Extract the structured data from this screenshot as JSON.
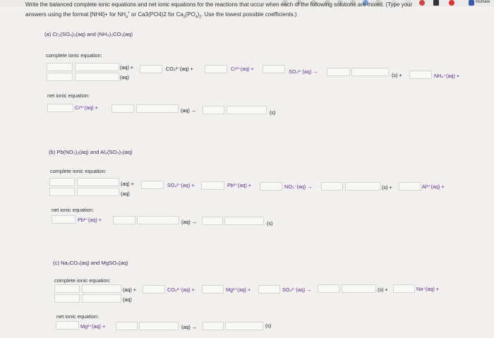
{
  "toolbar": {
    "homework_label": "Homew",
    "icons": [
      "circle-icon",
      "circle-icon",
      "circle-icon",
      "circle-icon",
      "check-icon",
      "puzzle-icon",
      "cloud-icon",
      "g-icon",
      "grid-icon",
      "n-icon",
      "p-icon",
      "record-icon",
      "w-icon"
    ]
  },
  "instructions": {
    "line1": "Write the balanced complete ionic equations and net ionic equations for the reactions that occur when each of the following solutions are mixed. (Type your",
    "line2_a": "answers using the format [NH4]+ for NH",
    "line2_b": "4",
    "line2_c": "+",
    "line2_d": " or Ca3(PO4)2 for Ca",
    "line2_e": "3",
    "line2_f": "(PO",
    "line2_g": "4",
    "line2_h": ")",
    "line2_i": "2",
    "line2_j": ". Use the lowest possible coefficients.)"
  },
  "part_a": {
    "title": "(a) Cr₂(SO₄)₃(aq) and (NH₄)₂CO₃(aq)",
    "complete_label": "complete ionic equation:",
    "c_aq_plus": "(aq) +",
    "c_aq": "(aq)",
    "c_co3": "CO₃²⁻(aq) +",
    "c_cr": "Cr³⁺(aq) +",
    "c_so4": "SO₄²⁻(aq) →",
    "c_s_plus": "(s) +",
    "c_nh4": "NH₄⁺(aq) +",
    "net_label": "net ionic equation:",
    "n_cr": "Cr³⁺(aq) +",
    "n_aq_arrow": "(aq) →",
    "n_s": "(s)"
  },
  "part_b": {
    "title": "(b) Pb(NO₃)₂(aq) and Al₂(SO₄)₃(aq)",
    "complete_label": "complete ionic equation:",
    "c_aq_plus": "(aq) +",
    "c_aq": "(aq)",
    "c_so4": "SO₄²⁻(aq) +",
    "c_pb": "Pb²⁺(aq) +",
    "c_no3": "NO₃⁻(aq) →",
    "c_s_plus": "(s) +",
    "c_al": "Al³⁺(aq) +",
    "net_label": "net ionic equation:",
    "n_pb": "Pb²⁺(aq) +",
    "n_aq_arrow": "(aq) →",
    "n_s": "(s)"
  },
  "part_c": {
    "title": "(c) Na₂CO₃(aq) and MgSO₄(aq)",
    "complete_label": "complete ionic equation:",
    "c_aq_plus": "(aq) +",
    "c_aq": "(aq)",
    "c_co3": "CO₃²⁻(aq) +",
    "c_mg": "Mg²⁺(aq) +",
    "c_so4": "SO₄²⁻(aq) →",
    "c_s_plus": "(s) +",
    "c_na": "Na⁺(aq) +",
    "net_label": "net ionic equation:",
    "n_mg": "Mg²⁺(aq) +",
    "n_aq_arrow": "(aq) →",
    "n_s": "(s)"
  },
  "colors": {
    "page_bg": "#f1f0ef",
    "input_bg": "#f8f8f7",
    "input_border": "#d4d4d2",
    "formula_color": "#5b2d86"
  }
}
